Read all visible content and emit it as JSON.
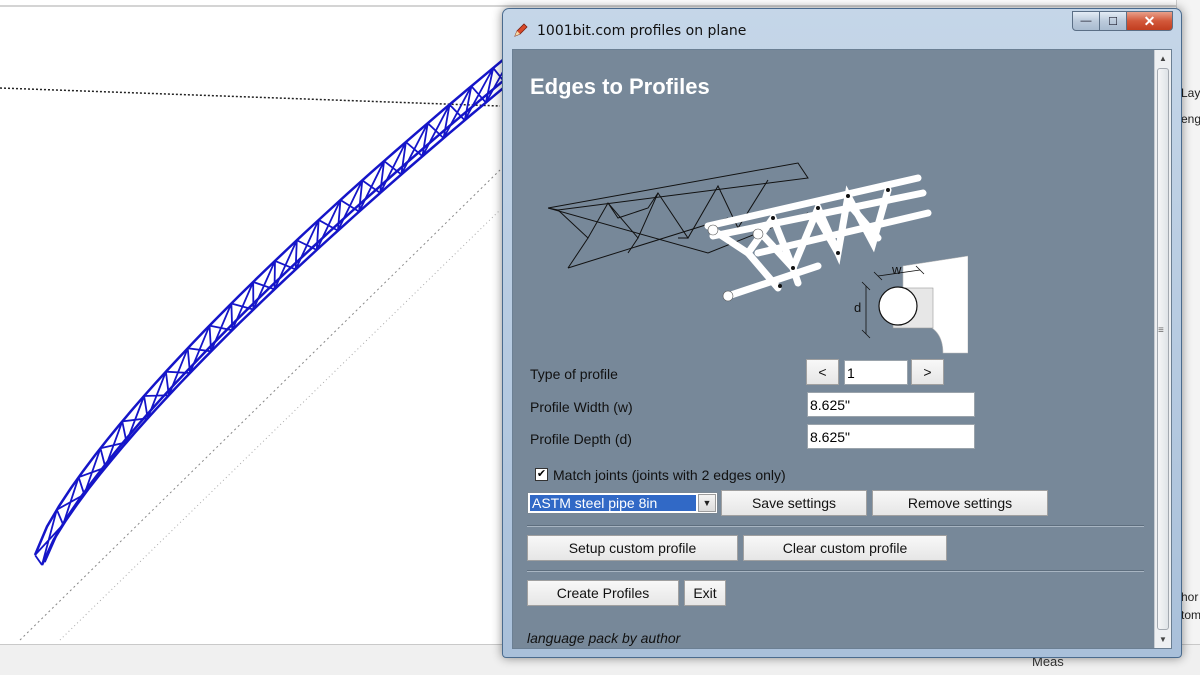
{
  "window": {
    "title": "1001bit.com profiles on plane",
    "minimize_glyph": "—",
    "maximize_glyph": "☐",
    "close_glyph": "✕"
  },
  "dialog": {
    "heading": "Edges to Profiles",
    "type_of_profile": {
      "label": "Type of profile",
      "prev_label": "<",
      "value": "1",
      "next_label": ">"
    },
    "profile_width": {
      "label": "Profile Width  (w)",
      "value": "8.625\""
    },
    "profile_depth": {
      "label": "Profile Depth  (d)",
      "value": "8.625\""
    },
    "match_joints": {
      "label": "Match joints (joints with 2 edges only)",
      "checked": true,
      "check_glyph": "✔"
    },
    "preset": {
      "selected": "ASTM steel pipe 8in",
      "arrow": "▼"
    },
    "buttons": {
      "save_settings": "Save settings",
      "remove_settings": "Remove settings",
      "setup_custom_profile": "Setup custom profile",
      "clear_custom_profile": "Clear custom profile",
      "create_profiles": "Create Profiles",
      "exit": "Exit"
    },
    "illustration_labels": {
      "width": "w",
      "depth": "d"
    },
    "footer": "language pack by author"
  },
  "background": {
    "status_label": "Meas",
    "right_panel_fragments": [
      "Lay",
      "eng",
      "hor",
      "tom"
    ]
  },
  "colors": {
    "client_bg": "#778899",
    "truss": "#1515c8",
    "selected_option": "#3169c6"
  }
}
